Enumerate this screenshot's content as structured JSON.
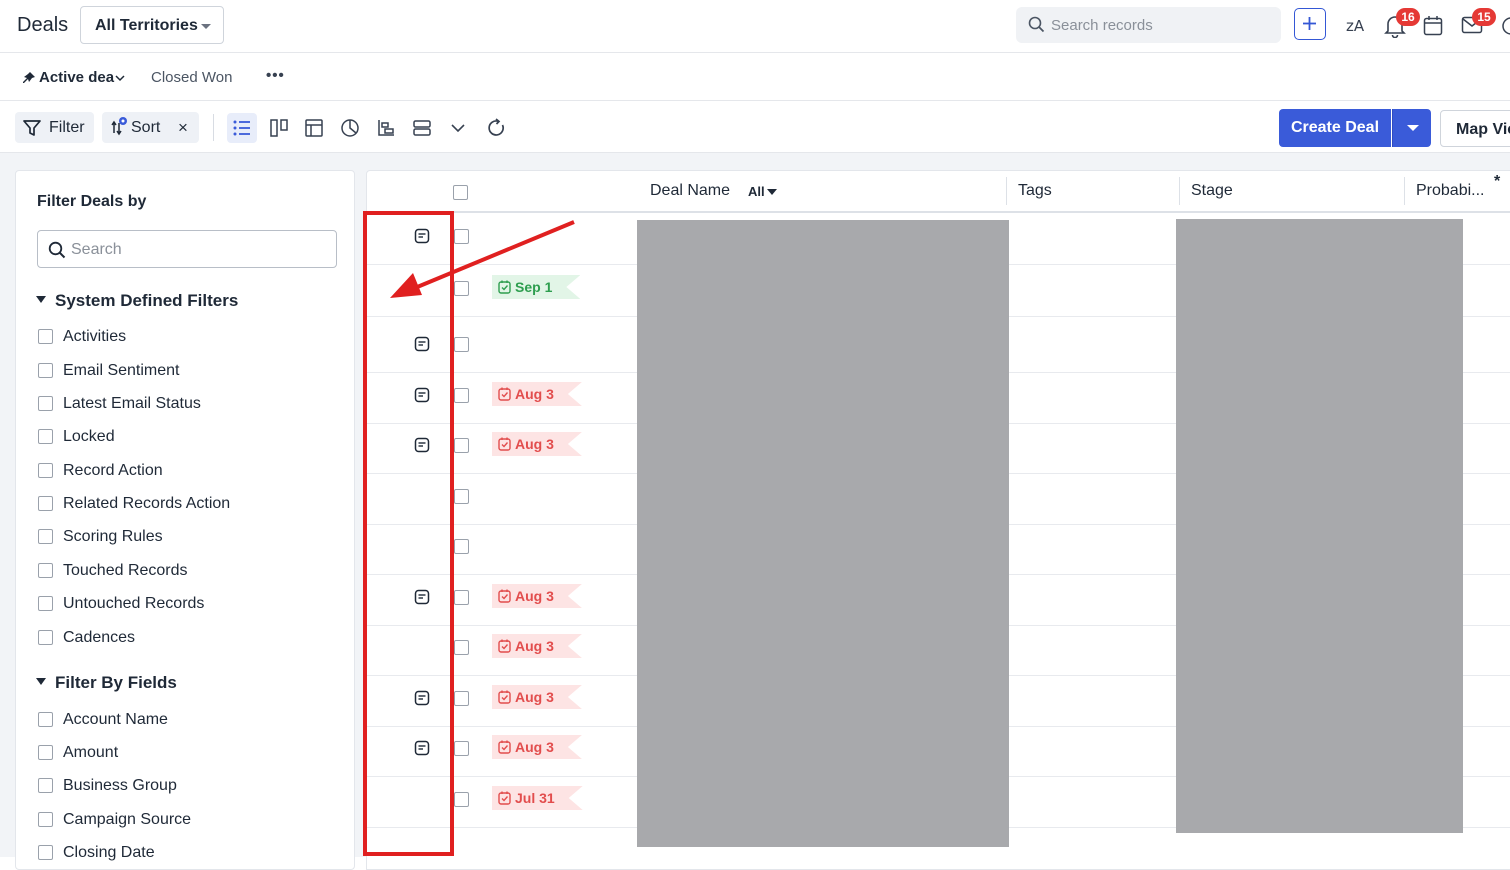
{
  "header": {
    "title": "Deals",
    "territory": "All Territories",
    "search_placeholder": "Search records",
    "notifications_count": "16",
    "mail_count": "15"
  },
  "views": {
    "active": "Active dea",
    "closed": "Closed Won",
    "more": "•••"
  },
  "toolbar": {
    "filter_label": "Filter",
    "sort_label": "Sort",
    "sort_clear": "×",
    "create_label": "Create Deal",
    "map_view_label": "Map Vie"
  },
  "filter_panel": {
    "title": "Filter Deals by",
    "search_placeholder": "Search",
    "system_section": "System Defined Filters",
    "system_filters": [
      "Activities",
      "Email Sentiment",
      "Latest Email Status",
      "Locked",
      "Record Action",
      "Related Records Action",
      "Scoring Rules",
      "Touched Records",
      "Untouched Records",
      "Cadences"
    ],
    "fields_section": "Filter By Fields",
    "field_filters": [
      "Account Name",
      "Amount",
      "Business Group",
      "Campaign Source",
      "Closing Date"
    ]
  },
  "table": {
    "columns": {
      "deal_name": "Deal Name",
      "deal_name_filter": "All",
      "tags": "Tags",
      "stage": "Stage",
      "probability": "Probabi...",
      "asterisk": "*"
    },
    "rows": [
      {
        "note": true,
        "tag": "",
        "tag_color": ""
      },
      {
        "note": false,
        "tag": "Sep 1",
        "tag_color": "green"
      },
      {
        "note": true,
        "tag": "",
        "tag_color": ""
      },
      {
        "note": true,
        "tag": "Aug 3",
        "tag_color": "red"
      },
      {
        "note": true,
        "tag": "Aug 3",
        "tag_color": "red"
      },
      {
        "note": false,
        "tag": "",
        "tag_color": ""
      },
      {
        "note": false,
        "tag": "",
        "tag_color": ""
      },
      {
        "note": true,
        "tag": "Aug 3",
        "tag_color": "red"
      },
      {
        "note": false,
        "tag": "Aug 3",
        "tag_color": "red"
      },
      {
        "note": true,
        "tag": "Aug 3",
        "tag_color": "red"
      },
      {
        "note": true,
        "tag": "Aug 3",
        "tag_color": "red"
      },
      {
        "note": false,
        "tag": "Jul 31",
        "tag_color": "red"
      }
    ]
  },
  "annotation": {
    "color": "#e02020",
    "arrow_icon": "arrow-pointer"
  },
  "colors": {
    "primary": "#3a5bd9",
    "badge": "#e53935",
    "tag_red": "#e24d4d",
    "tag_green": "#2e9e4f",
    "redaction": "#a8a9ac"
  }
}
